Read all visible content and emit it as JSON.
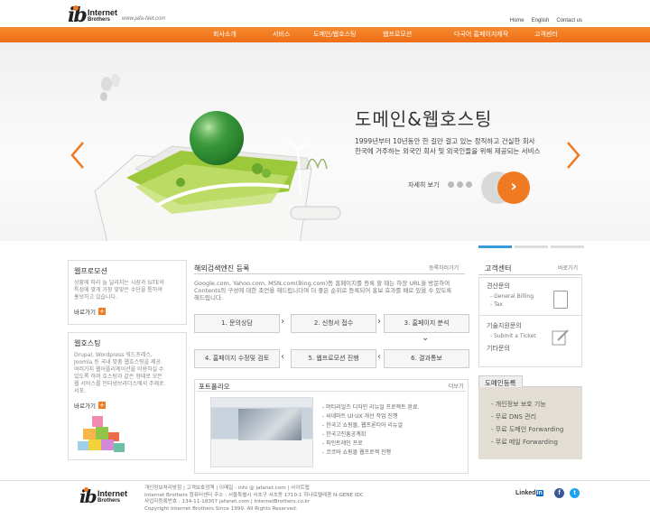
{
  "header": {
    "logo_ib": "ib",
    "logo_line1": "Internet",
    "logo_line2": "Brothers",
    "logo_url": "www.jafa-Net.com",
    "toplinks": [
      "Home",
      "English",
      "Contact us"
    ]
  },
  "nav": [
    "회사소개",
    "서비스",
    "도메인/웹호스팅",
    "웹프로모션",
    "다국어 홈페이지제작",
    "고객센터"
  ],
  "hero": {
    "title": "도메인&웹호스팅",
    "desc_line1": "1999년부터 10년동안 한 길만 걸고 있는 정직하고 건실한 회사",
    "desc_line2": "한국에 거주하는 외국인 회사 및 외국인들을 위해 제공되는 서비스",
    "more_label": "자세히 보기",
    "more_icon": "chevron-right-icon"
  },
  "left": {
    "promo": {
      "title": "웹프로모션",
      "text": [
        "상황에 따라 늘 달라지는 시장과 SITE의",
        "특성에 맞게 가장 맞맞은 수단을 통하여",
        "홍보하고 있습니다."
      ],
      "go_label": "바로가기"
    },
    "hosting": {
      "title": "웹호스팅",
      "text": [
        "Drupal, Wordpress 워드프레스,",
        "Joomla 등 국내 맞춤 웹호스팅을 제공.",
        "여러가지 웹어플리케이션을 이용하실 수",
        "있도록 하며 호스팅과 같은 형태로 모든",
        "웹 서비스를 인터넷브라더스에서 주제로",
        "서포."
      ],
      "go_label": "바로가기"
    }
  },
  "center": {
    "title": "해외검색엔진 등록",
    "more": "등록하러가기",
    "desc": [
      "Google.com, Yahoo.com, MSN.com(Bing.com)등 홈페이지를 등록 할 때는 하장 URL을 방문하여",
      "Contents의 구성에 대한 조언을 해드립니다며 더 좋은 순위로 등록되어 홍보 효과를 배로 있을 수 있도록",
      "해드립니다."
    ],
    "steps": [
      "1. 문의상담",
      "2. 신청서 접수",
      "3. 홈페이지 분석",
      "4. 홈페이지 수정및 검토",
      "5. 웹프로모션 진행",
      "6. 결과통보"
    ],
    "portfolio": {
      "title": "포트폴리오",
      "more": "더보기",
      "items": [
        "- 머티리얼즈 디자인 리뉴얼 프로젝트 완료.",
        "- 씨네마트 UI·UX 개선 작업 진행",
        "- 한국고 쇼핑몰, 웹프론티어 리뉴얼",
        "- 한국고진흥공계회",
        "- 파인트레인 프로",
        "- 코코바 쇼핑몰 웹프로젝 진행"
      ]
    }
  },
  "right": {
    "title": "고객센터",
    "more": "바로가기",
    "box1_title": "견산문의",
    "box1_items": [
      "- General Billing",
      "- Tax"
    ],
    "box2_title": "기술지원문의",
    "box2_items": [
      "- Submit a Ticket"
    ],
    "box2_etc": "기타문의",
    "domain_tab": "도메인등록",
    "domain_items": [
      "- 개인정보 보호 기능",
      "- 무료 DNS 관리",
      "- 무료 도메인 Forwarding",
      "- 무료 메일 Forwarding"
    ]
  },
  "footer": {
    "logo_ib": "ib",
    "logo_line1": "Internet",
    "logo_line2": "Brothers",
    "lines": [
      "개인정보처리방침 | 고객보호정책 | 이메일 : info @ jafanet.com | 사이트맵",
      "Internet Brothers 컴퓨터센터 주소 : 서울특별시 서초구 서초동 1710-1 하나로텔레콤 N-GENE IDC",
      "사업자등록번호 : 134-11-18307 jafanet.com | InternetBrothers.co.kr",
      "Copyright Internet Brothers Since 1999. All Rights Reserved."
    ],
    "linkedin_text": "Linked",
    "linkedin_in": "in",
    "social": [
      "f",
      "t"
    ],
    "colors": {
      "facebook": "#3b5998",
      "twitter": "#1da1f2"
    }
  },
  "colors": {
    "accent": "#f07a22",
    "tab_active": "#3a9ad9"
  }
}
